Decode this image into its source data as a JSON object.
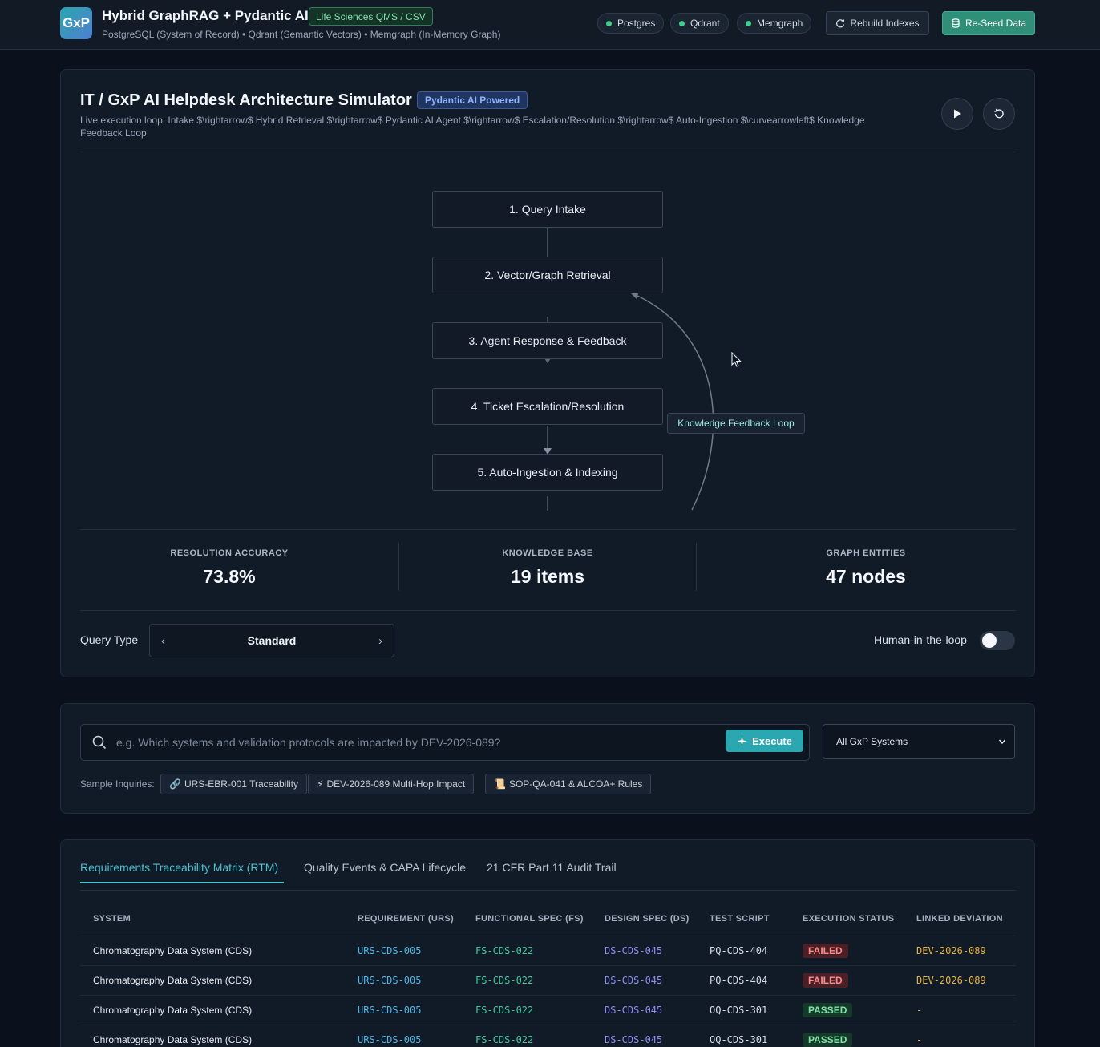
{
  "header": {
    "logo_text": "GxP",
    "title": "Hybrid GraphRAG + Pydantic AI",
    "domain_badge": "Life Sciences QMS / CSV",
    "subtitle": "PostgreSQL (System of Record) • Qdrant (Semantic Vectors) • Memgraph (In-Memory Graph)",
    "status": [
      "Postgres",
      "Qdrant",
      "Memgraph"
    ],
    "rebuild_label": "Rebuild Indexes",
    "reseed_label": "Re-Seed Data",
    "status_color": "#3fcf8e",
    "accent_color": "#2f8f78"
  },
  "simulator": {
    "title": "IT / GxP AI Helpdesk Architecture Simulator",
    "badge": "Pydantic AI Powered",
    "description": "Live execution loop: Intake $\\rightarrow$ Hybrid Retrieval $\\rightarrow$ Pydantic AI Agent $\\rightarrow$ Escalation/Resolution $\\rightarrow$ Auto-Ingestion $\\curvearrowleft$ Knowledge Feedback Loop",
    "nodes": [
      "1. Query Intake",
      "2. Vector/Graph Retrieval",
      "3. Agent Response & Feedback",
      "4. Ticket Escalation/Resolution",
      "5. Auto-Ingestion & Indexing"
    ],
    "loop_label": "Knowledge Feedback Loop",
    "metrics": [
      {
        "label": "RESOLUTION ACCURACY",
        "value": "73.8%"
      },
      {
        "label": "KNOWLEDGE BASE",
        "value": "19 items"
      },
      {
        "label": "GRAPH ENTITIES",
        "value": "47 nodes"
      }
    ],
    "query_type_label": "Query Type",
    "query_type_value": "Standard",
    "hitl_label": "Human-in-the-loop",
    "hitl_enabled": false
  },
  "query": {
    "placeholder": "e.g. Which systems and validation protocols are impacted by DEV-2026-089?",
    "execute_label": "Execute",
    "system_select": "All GxP Systems",
    "samples_label": "Sample Inquiries:",
    "samples": [
      {
        "icon": "🔗",
        "label": "URS-EBR-001 Traceability"
      },
      {
        "icon": "⚡",
        "label": "DEV-2026-089 Multi-Hop Impact"
      },
      {
        "icon": "📜",
        "label": "SOP-QA-041 & ALCOA+ Rules"
      }
    ]
  },
  "tabs": [
    "Requirements Traceability Matrix (RTM)",
    "Quality Events & CAPA Lifecycle",
    "21 CFR Part 11 Audit Trail"
  ],
  "rtm": {
    "columns": [
      "SYSTEM",
      "REQUIREMENT (URS)",
      "FUNCTIONAL SPEC (FS)",
      "DESIGN SPEC (DS)",
      "TEST SCRIPT",
      "EXECUTION STATUS",
      "LINKED DEVIATION"
    ],
    "rows": [
      {
        "system": "Chromatography Data System (CDS)",
        "urs": "URS-CDS-005",
        "fs": "FS-CDS-022",
        "ds": "DS-CDS-045",
        "test": "PQ-CDS-404",
        "status": "FAILED",
        "deviation": "DEV-2026-089"
      },
      {
        "system": "Chromatography Data System (CDS)",
        "urs": "URS-CDS-005",
        "fs": "FS-CDS-022",
        "ds": "DS-CDS-045",
        "test": "PQ-CDS-404",
        "status": "FAILED",
        "deviation": "DEV-2026-089"
      },
      {
        "system": "Chromatography Data System (CDS)",
        "urs": "URS-CDS-005",
        "fs": "FS-CDS-022",
        "ds": "DS-CDS-045",
        "test": "OQ-CDS-301",
        "status": "PASSED",
        "deviation": "-"
      },
      {
        "system": "Chromatography Data System (CDS)",
        "urs": "URS-CDS-005",
        "fs": "FS-CDS-022",
        "ds": "DS-CDS-045",
        "test": "OQ-CDS-301",
        "status": "PASSED",
        "deviation": "-"
      }
    ]
  }
}
